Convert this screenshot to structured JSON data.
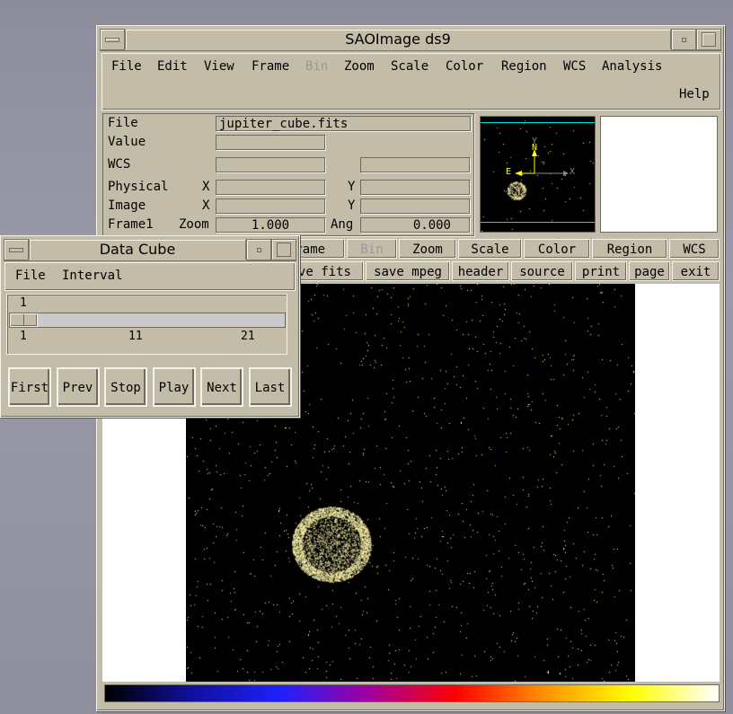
{
  "main_window": {
    "title": "SAOImage ds9",
    "menu": [
      "File",
      "Edit",
      "View",
      "Frame",
      "Bin",
      "Zoom",
      "Scale",
      "Color",
      "Region",
      "WCS",
      "Analysis"
    ],
    "menu_disabled": [
      "Bin"
    ],
    "help": "Help",
    "info": {
      "file_label": "File",
      "file_value": "jupiter_cube.fits",
      "value_label": "Value",
      "wcs_label": "WCS",
      "physical_label": "Physical",
      "image_label": "Image",
      "x_label": "X",
      "y_label": "Y",
      "frame_label": "Frame1",
      "zoom_label": "Zoom",
      "zoom_value": "1.000",
      "ang_label": "Ang",
      "ang_value": "0.000"
    },
    "panner": {
      "north": "N",
      "east": "E",
      "x_axis": "X",
      "y_axis": "Y",
      "compass_color": "#ffff00",
      "bbox_color": "#00e0e0"
    },
    "buttons_row1": [
      "Frame",
      "Bin",
      "Zoom",
      "Scale",
      "Color",
      "Region",
      "WCS"
    ],
    "buttons_row2": [
      "save fits",
      "save mpeg",
      "header",
      "source",
      "print",
      "page",
      "exit"
    ],
    "colormap": [
      "#000000",
      "#1010a0",
      "#2020ff",
      "#a000a0",
      "#ff0000",
      "#ff9000",
      "#ffff00",
      "#ffffff"
    ]
  },
  "data_cube": {
    "title": "Data Cube",
    "menu": [
      "File",
      "Interval"
    ],
    "slider": {
      "current": "1",
      "min": "1",
      "mid": "11",
      "max": "21",
      "value": 1,
      "range": [
        1,
        21
      ]
    },
    "buttons": [
      "First",
      "Prev",
      "Stop",
      "Play",
      "Next",
      "Last"
    ]
  }
}
